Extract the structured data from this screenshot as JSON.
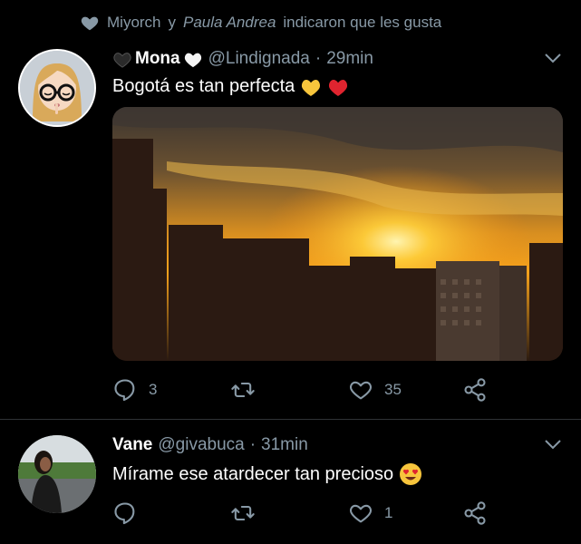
{
  "liked_banner": {
    "user1": "Miyorch",
    "connector": "y",
    "user2": "Paula Andrea",
    "suffix": "indicaron que les gusta"
  },
  "tweets": [
    {
      "name": "Mona",
      "handle": "@Lindignada",
      "separator": "·",
      "time": "29min",
      "text": "Bogotá es tan perfecta",
      "emoji": [
        "yellow-heart",
        "red-heart"
      ],
      "replies": "3",
      "retweets": "",
      "likes": "35"
    },
    {
      "name": "Vane",
      "handle": "@givabuca",
      "separator": "·",
      "time": "31min",
      "text": "Mírame ese atardecer tan precioso",
      "emoji": [
        "heart-eyes-emoji"
      ],
      "replies": "",
      "retweets": "",
      "likes": "1"
    }
  ],
  "colors": {
    "background": "#000000",
    "secondary_text": "#8899a6",
    "divider": "#2f3336",
    "yellow_heart": "#f7c53c",
    "red_heart": "#e0242f"
  }
}
